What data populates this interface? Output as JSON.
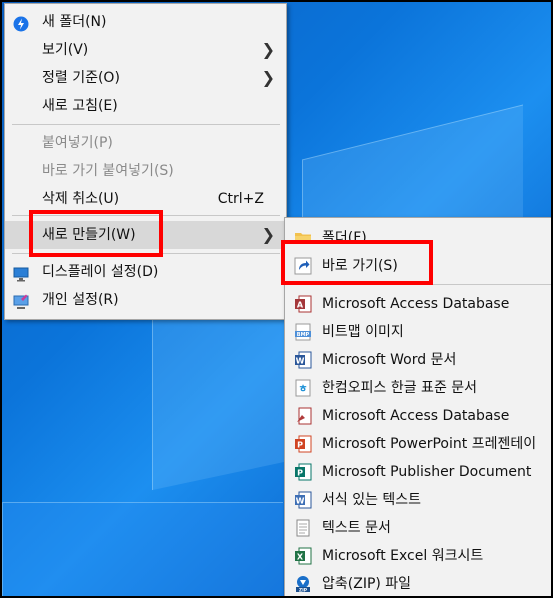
{
  "context_menu": {
    "items": [
      {
        "label": "새 폴더(N)"
      },
      {
        "label": "보기(V)"
      },
      {
        "label": "정렬 기준(O)"
      },
      {
        "label": "새로 고침(E)"
      },
      {
        "label": "붙여넣기(P)"
      },
      {
        "label": "바로 가기 붙여넣기(S)"
      },
      {
        "label": "삭제 취소(U)",
        "shortcut": "Ctrl+Z"
      },
      {
        "label": "새로 만들기(W)"
      },
      {
        "label": "디스플레이 설정(D)"
      },
      {
        "label": "개인 설정(R)"
      }
    ]
  },
  "submenu": {
    "items": [
      {
        "label": "폴더(F)",
        "icon": "folder-icon"
      },
      {
        "label": "바로 가기(S)",
        "icon": "shortcut-icon"
      },
      {
        "label": "Microsoft Access Database",
        "icon": "access-icon"
      },
      {
        "label": "비트맵 이미지",
        "icon": "bitmap-icon"
      },
      {
        "label": "Microsoft Word 문서",
        "icon": "word-icon"
      },
      {
        "label": "한컴오피스 한글 표준 문서",
        "icon": "hwp-icon"
      },
      {
        "label": "Microsoft Access Database",
        "icon": "access-icon"
      },
      {
        "label": "Microsoft PowerPoint 프레젠테이",
        "icon": "powerpoint-icon"
      },
      {
        "label": "Microsoft Publisher Document",
        "icon": "publisher-icon"
      },
      {
        "label": "서식 있는 텍스트",
        "icon": "rtf-icon"
      },
      {
        "label": "텍스트 문서",
        "icon": "text-doc-icon"
      },
      {
        "label": "Microsoft Excel 워크시트",
        "icon": "excel-icon"
      },
      {
        "label": "압축(ZIP) 파일",
        "icon": "zip-icon"
      }
    ]
  },
  "colors": {
    "highlight": "#ff0000",
    "menu_bg": "#f2f2f2",
    "desktop": "#0b74da"
  }
}
